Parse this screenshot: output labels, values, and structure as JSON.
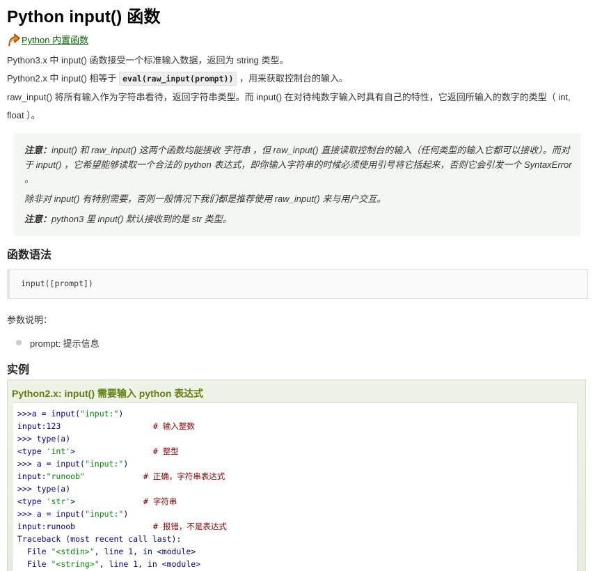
{
  "title": "Python input() 函数",
  "back_link": {
    "label": "Python 内置函数",
    "icon": "up-arrow-icon"
  },
  "paragraphs": {
    "p1": "Python3.x 中 input() 函数接受一个标准输入数据，返回为 string 类型。",
    "p2_before": "Python2.x 中 input() 相等于 ",
    "p2_code": "eval(raw_input(prompt))",
    "p2_after": " ，用来获取控制台的输入。",
    "p3": "raw_input() 将所有输入作为字符串看待，返回字符串类型。而 input() 在对待纯数字输入时具有自己的特性，它返回所输入的数字的类型（ int, float ）。"
  },
  "note": {
    "n1_label": "注意：",
    "n1_text": "input() 和 raw_input() 这两个函数均能接收 字符串 ，但 raw_input() 直接读取控制台的输入（任何类型的输入它都可以接收）。而对于 input() ，它希望能够读取一个合法的 python 表达式，即你输入字符串的时候必须使用引号将它括起来，否则它会引发一个 SyntaxError 。",
    "n2_text": "除非对 input() 有特别需要，否则一般情况下我们都是推荐使用 raw_input() 来与用户交互。",
    "n3_label": "注意：",
    "n3_text": "python3 里 input() 默认接收到的是 str 类型。"
  },
  "syntax": {
    "heading": "函数语法",
    "code": "input([prompt])"
  },
  "params": {
    "label": "参数说明：",
    "items": [
      "prompt: 提示信息"
    ]
  },
  "example": {
    "heading": "实例",
    "title": "Python2.x: input() 需要输入 python 表达式",
    "lines": [
      {
        "code": ">>>a = input(\"input:\")",
        "comment": ""
      },
      {
        "code": "input:123",
        "comment": "# 输入整数"
      },
      {
        "code": ">>> type(a)",
        "comment": ""
      },
      {
        "code": "<type 'int'>",
        "comment": "# 整型"
      },
      {
        "code": ">>> a = input(\"input:\")",
        "comment": ""
      },
      {
        "code": "input:\"runoob\"",
        "comment": "# 正确，字符串表达式"
      },
      {
        "code": ">>> type(a)",
        "comment": ""
      },
      {
        "code": "<type 'str'>",
        "comment": "# 字符串"
      },
      {
        "code": ">>> a = input(\"input:\")",
        "comment": ""
      },
      {
        "code": "input:runoob",
        "comment": "# 报错，不是表达式"
      },
      {
        "code": "Traceback (most recent call last):",
        "comment": ""
      },
      {
        "code": "  File \"<stdin>\", line 1, in <module>",
        "comment": ""
      },
      {
        "code": "  File \"<string>\", line 1, in <module>",
        "comment": ""
      }
    ]
  },
  "colors": {
    "link": "#006600",
    "example_title": "#617f10",
    "note_bg": "#f4f6f2",
    "comment": "#880000",
    "string": "#008800",
    "keyword": "#000088"
  }
}
